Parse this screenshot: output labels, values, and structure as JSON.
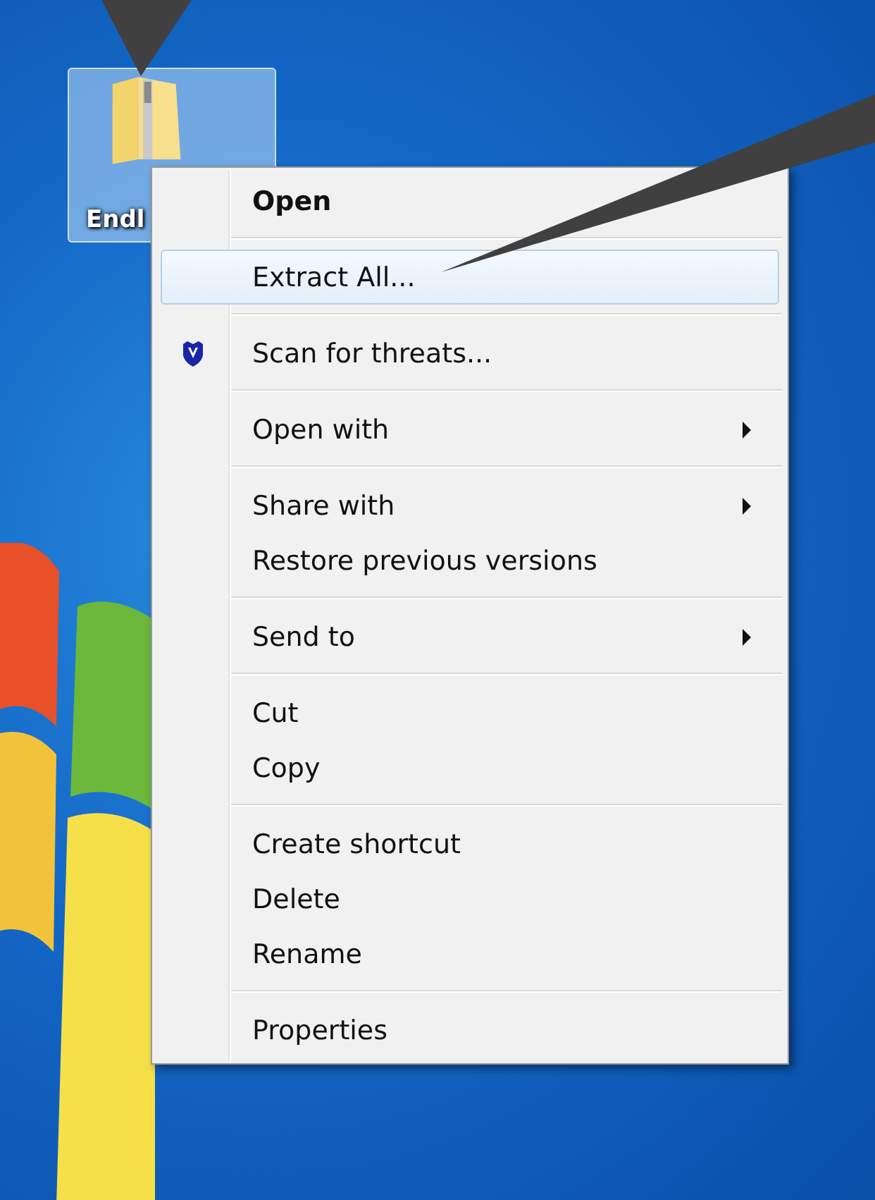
{
  "desktop_icon": {
    "label": "Endl",
    "selected": true
  },
  "context_menu": {
    "groups": [
      {
        "items": [
          {
            "label": "Open",
            "kind": "default",
            "selected": false,
            "submenu": false
          }
        ]
      },
      {
        "items": [
          {
            "label": "Extract All...",
            "kind": "plain",
            "selected": true,
            "submenu": false
          }
        ]
      },
      {
        "items": [
          {
            "label": "Scan for threats...",
            "kind": "with-icon",
            "selected": false,
            "submenu": false
          }
        ]
      },
      {
        "items": [
          {
            "label": "Open with",
            "kind": "plain",
            "selected": false,
            "submenu": true
          }
        ]
      },
      {
        "items": [
          {
            "label": "Share with",
            "kind": "plain",
            "selected": false,
            "submenu": true
          },
          {
            "label": "Restore previous versions",
            "kind": "plain",
            "selected": false,
            "submenu": false
          }
        ]
      },
      {
        "items": [
          {
            "label": "Send to",
            "kind": "plain",
            "selected": false,
            "submenu": true
          }
        ]
      },
      {
        "items": [
          {
            "label": "Cut",
            "kind": "plain",
            "selected": false,
            "submenu": false
          },
          {
            "label": "Copy",
            "kind": "plain",
            "selected": false,
            "submenu": false
          }
        ]
      },
      {
        "items": [
          {
            "label": "Create shortcut",
            "kind": "plain",
            "selected": false,
            "submenu": false
          },
          {
            "label": "Delete",
            "kind": "plain",
            "selected": false,
            "submenu": false
          },
          {
            "label": "Rename",
            "kind": "plain",
            "selected": false,
            "submenu": false
          }
        ]
      },
      {
        "items": [
          {
            "label": "Properties",
            "kind": "plain",
            "selected": false,
            "submenu": false
          }
        ]
      }
    ]
  }
}
